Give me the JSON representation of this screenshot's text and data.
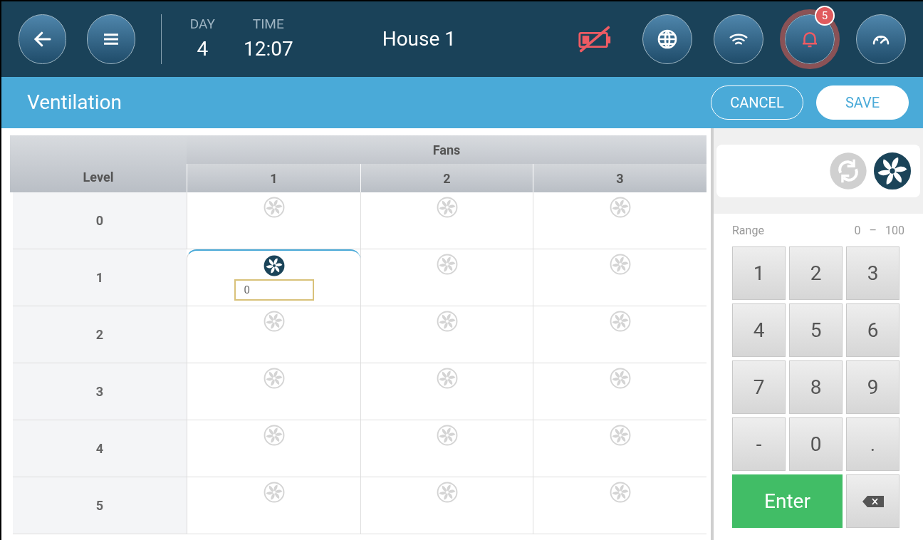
{
  "header": {
    "day_label": "DAY",
    "day": "4",
    "time_label": "TIME",
    "time": "12:07",
    "house": "House 1",
    "alarm_count": "5"
  },
  "page": {
    "title": "Ventilation",
    "buttons": [
      {
        "label": "CANCEL",
        "kind": "outline"
      },
      {
        "label": "SAVE",
        "kind": "solid"
      }
    ]
  },
  "table": {
    "group_header": "Fans",
    "level_header": "Level",
    "columns": [
      "1",
      "2",
      "3"
    ],
    "rows": [
      {
        "level": "0",
        "cells": [
          {
            "on": false,
            "selected": false
          },
          {
            "on": false,
            "selected": false
          },
          {
            "on": false,
            "selected": false
          }
        ]
      },
      {
        "level": "1",
        "cells": [
          {
            "on": true,
            "selected": true,
            "value": "0"
          },
          {
            "on": false,
            "selected": false
          },
          {
            "on": false,
            "selected": false
          }
        ]
      },
      {
        "level": "2",
        "cells": [
          {
            "on": false,
            "selected": false
          },
          {
            "on": false,
            "selected": false
          },
          {
            "on": false,
            "selected": false
          }
        ]
      },
      {
        "level": "3",
        "cells": [
          {
            "on": false,
            "selected": false
          },
          {
            "on": false,
            "selected": false
          },
          {
            "on": false,
            "selected": false
          }
        ]
      },
      {
        "level": "4",
        "cells": [
          {
            "on": false,
            "selected": false
          },
          {
            "on": false,
            "selected": false
          },
          {
            "on": false,
            "selected": false
          }
        ]
      },
      {
        "level": "5",
        "cells": [
          {
            "on": false,
            "selected": false
          },
          {
            "on": false,
            "selected": false
          },
          {
            "on": false,
            "selected": false
          }
        ]
      }
    ]
  },
  "mode": [
    {
      "kind": "auto",
      "selected": false
    },
    {
      "kind": "fan",
      "selected": true
    }
  ],
  "keypad": {
    "range_label": "Range",
    "range_min": "0",
    "range_sep": "–",
    "range_max": "100",
    "keys": [
      {
        "kind": "key",
        "label": "1"
      },
      {
        "kind": "key",
        "label": "2"
      },
      {
        "kind": "key",
        "label": "3"
      },
      {
        "kind": "key",
        "label": "4"
      },
      {
        "kind": "key",
        "label": "5"
      },
      {
        "kind": "key",
        "label": "6"
      },
      {
        "kind": "key",
        "label": "7"
      },
      {
        "kind": "key",
        "label": "8"
      },
      {
        "kind": "key",
        "label": "9"
      },
      {
        "kind": "key",
        "label": "-"
      },
      {
        "kind": "key",
        "label": "0"
      },
      {
        "kind": "key",
        "label": "."
      },
      {
        "kind": "enter",
        "label": "Enter"
      },
      {
        "kind": "backspace"
      }
    ]
  }
}
